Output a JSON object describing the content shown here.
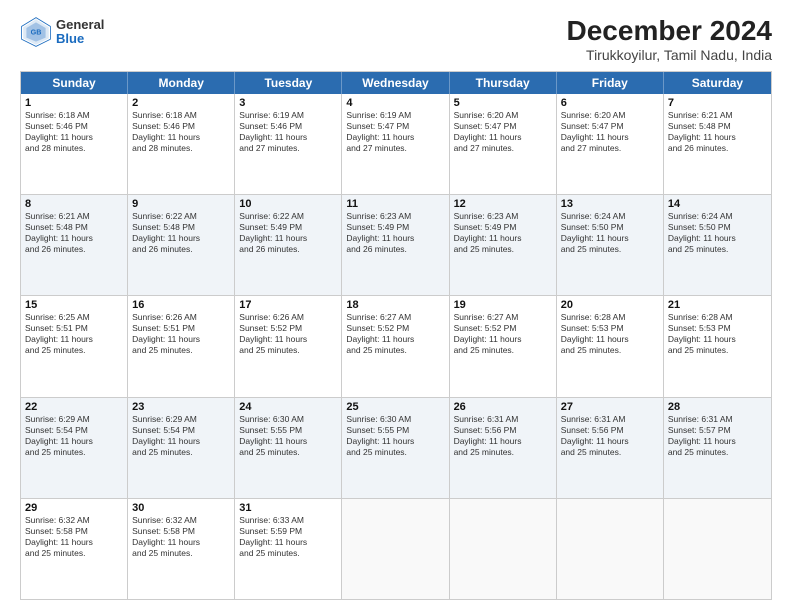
{
  "logo": {
    "general": "General",
    "blue": "Blue"
  },
  "title": "December 2024",
  "subtitle": "Tirukkoyilur, Tamil Nadu, India",
  "header_days": [
    "Sunday",
    "Monday",
    "Tuesday",
    "Wednesday",
    "Thursday",
    "Friday",
    "Saturday"
  ],
  "rows": [
    [
      {
        "day": "1",
        "lines": [
          "Sunrise: 6:18 AM",
          "Sunset: 5:46 PM",
          "Daylight: 11 hours",
          "and 28 minutes."
        ]
      },
      {
        "day": "2",
        "lines": [
          "Sunrise: 6:18 AM",
          "Sunset: 5:46 PM",
          "Daylight: 11 hours",
          "and 28 minutes."
        ]
      },
      {
        "day": "3",
        "lines": [
          "Sunrise: 6:19 AM",
          "Sunset: 5:46 PM",
          "Daylight: 11 hours",
          "and 27 minutes."
        ]
      },
      {
        "day": "4",
        "lines": [
          "Sunrise: 6:19 AM",
          "Sunset: 5:47 PM",
          "Daylight: 11 hours",
          "and 27 minutes."
        ]
      },
      {
        "day": "5",
        "lines": [
          "Sunrise: 6:20 AM",
          "Sunset: 5:47 PM",
          "Daylight: 11 hours",
          "and 27 minutes."
        ]
      },
      {
        "day": "6",
        "lines": [
          "Sunrise: 6:20 AM",
          "Sunset: 5:47 PM",
          "Daylight: 11 hours",
          "and 27 minutes."
        ]
      },
      {
        "day": "7",
        "lines": [
          "Sunrise: 6:21 AM",
          "Sunset: 5:48 PM",
          "Daylight: 11 hours",
          "and 26 minutes."
        ]
      }
    ],
    [
      {
        "day": "8",
        "lines": [
          "Sunrise: 6:21 AM",
          "Sunset: 5:48 PM",
          "Daylight: 11 hours",
          "and 26 minutes."
        ]
      },
      {
        "day": "9",
        "lines": [
          "Sunrise: 6:22 AM",
          "Sunset: 5:48 PM",
          "Daylight: 11 hours",
          "and 26 minutes."
        ]
      },
      {
        "day": "10",
        "lines": [
          "Sunrise: 6:22 AM",
          "Sunset: 5:49 PM",
          "Daylight: 11 hours",
          "and 26 minutes."
        ]
      },
      {
        "day": "11",
        "lines": [
          "Sunrise: 6:23 AM",
          "Sunset: 5:49 PM",
          "Daylight: 11 hours",
          "and 26 minutes."
        ]
      },
      {
        "day": "12",
        "lines": [
          "Sunrise: 6:23 AM",
          "Sunset: 5:49 PM",
          "Daylight: 11 hours",
          "and 25 minutes."
        ]
      },
      {
        "day": "13",
        "lines": [
          "Sunrise: 6:24 AM",
          "Sunset: 5:50 PM",
          "Daylight: 11 hours",
          "and 25 minutes."
        ]
      },
      {
        "day": "14",
        "lines": [
          "Sunrise: 6:24 AM",
          "Sunset: 5:50 PM",
          "Daylight: 11 hours",
          "and 25 minutes."
        ]
      }
    ],
    [
      {
        "day": "15",
        "lines": [
          "Sunrise: 6:25 AM",
          "Sunset: 5:51 PM",
          "Daylight: 11 hours",
          "and 25 minutes."
        ]
      },
      {
        "day": "16",
        "lines": [
          "Sunrise: 6:26 AM",
          "Sunset: 5:51 PM",
          "Daylight: 11 hours",
          "and 25 minutes."
        ]
      },
      {
        "day": "17",
        "lines": [
          "Sunrise: 6:26 AM",
          "Sunset: 5:52 PM",
          "Daylight: 11 hours",
          "and 25 minutes."
        ]
      },
      {
        "day": "18",
        "lines": [
          "Sunrise: 6:27 AM",
          "Sunset: 5:52 PM",
          "Daylight: 11 hours",
          "and 25 minutes."
        ]
      },
      {
        "day": "19",
        "lines": [
          "Sunrise: 6:27 AM",
          "Sunset: 5:52 PM",
          "Daylight: 11 hours",
          "and 25 minutes."
        ]
      },
      {
        "day": "20",
        "lines": [
          "Sunrise: 6:28 AM",
          "Sunset: 5:53 PM",
          "Daylight: 11 hours",
          "and 25 minutes."
        ]
      },
      {
        "day": "21",
        "lines": [
          "Sunrise: 6:28 AM",
          "Sunset: 5:53 PM",
          "Daylight: 11 hours",
          "and 25 minutes."
        ]
      }
    ],
    [
      {
        "day": "22",
        "lines": [
          "Sunrise: 6:29 AM",
          "Sunset: 5:54 PM",
          "Daylight: 11 hours",
          "and 25 minutes."
        ]
      },
      {
        "day": "23",
        "lines": [
          "Sunrise: 6:29 AM",
          "Sunset: 5:54 PM",
          "Daylight: 11 hours",
          "and 25 minutes."
        ]
      },
      {
        "day": "24",
        "lines": [
          "Sunrise: 6:30 AM",
          "Sunset: 5:55 PM",
          "Daylight: 11 hours",
          "and 25 minutes."
        ]
      },
      {
        "day": "25",
        "lines": [
          "Sunrise: 6:30 AM",
          "Sunset: 5:55 PM",
          "Daylight: 11 hours",
          "and 25 minutes."
        ]
      },
      {
        "day": "26",
        "lines": [
          "Sunrise: 6:31 AM",
          "Sunset: 5:56 PM",
          "Daylight: 11 hours",
          "and 25 minutes."
        ]
      },
      {
        "day": "27",
        "lines": [
          "Sunrise: 6:31 AM",
          "Sunset: 5:56 PM",
          "Daylight: 11 hours",
          "and 25 minutes."
        ]
      },
      {
        "day": "28",
        "lines": [
          "Sunrise: 6:31 AM",
          "Sunset: 5:57 PM",
          "Daylight: 11 hours",
          "and 25 minutes."
        ]
      }
    ],
    [
      {
        "day": "29",
        "lines": [
          "Sunrise: 6:32 AM",
          "Sunset: 5:58 PM",
          "Daylight: 11 hours",
          "and 25 minutes."
        ]
      },
      {
        "day": "30",
        "lines": [
          "Sunrise: 6:32 AM",
          "Sunset: 5:58 PM",
          "Daylight: 11 hours",
          "and 25 minutes."
        ]
      },
      {
        "day": "31",
        "lines": [
          "Sunrise: 6:33 AM",
          "Sunset: 5:59 PM",
          "Daylight: 11 hours",
          "and 25 minutes."
        ]
      },
      {
        "day": "",
        "lines": []
      },
      {
        "day": "",
        "lines": []
      },
      {
        "day": "",
        "lines": []
      },
      {
        "day": "",
        "lines": []
      }
    ]
  ]
}
